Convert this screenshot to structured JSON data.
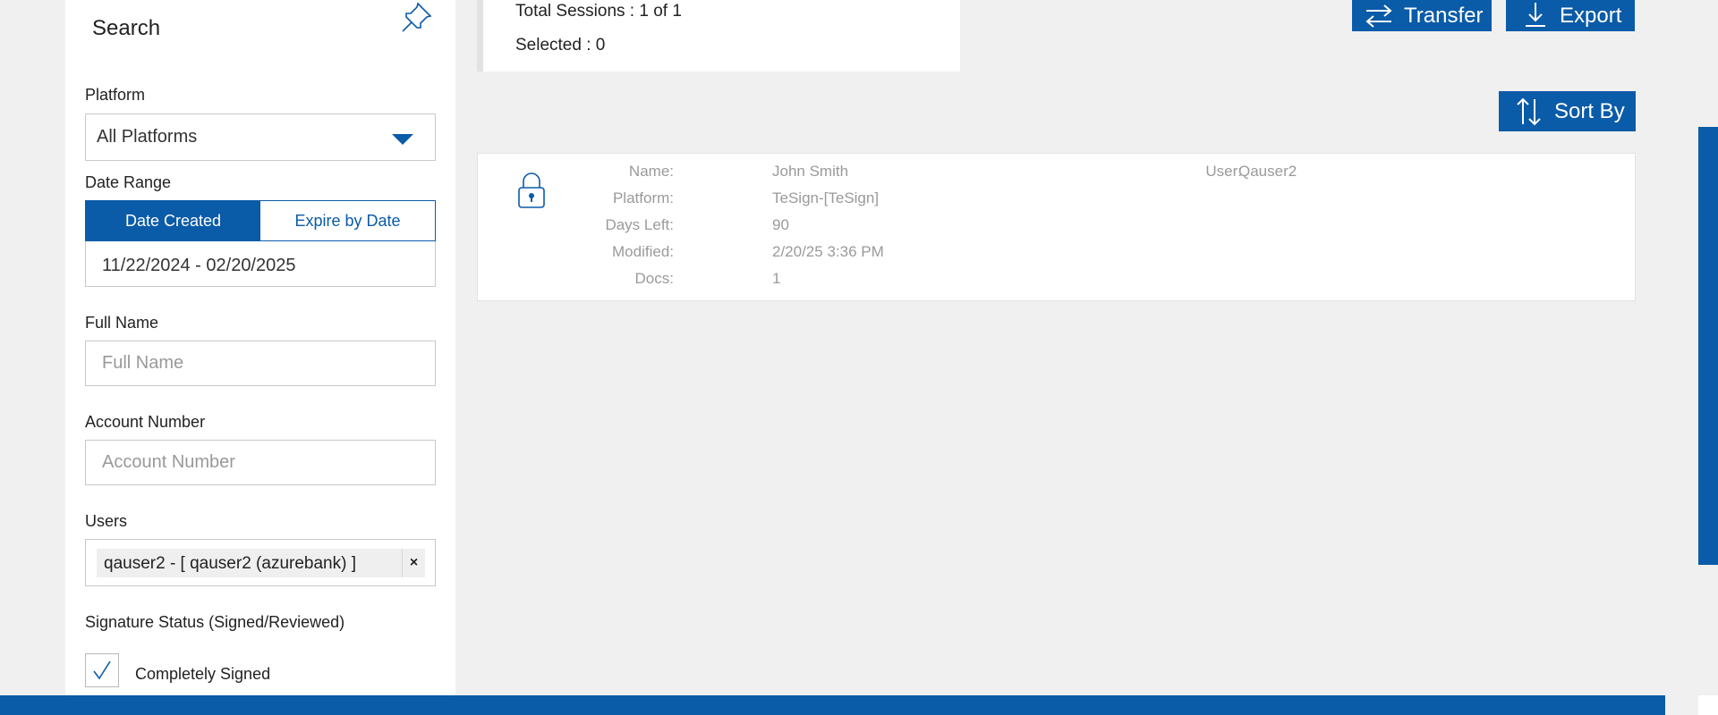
{
  "search_panel": {
    "title": "Search",
    "platform": {
      "label": "Platform",
      "value": "All Platforms"
    },
    "date_range": {
      "label": "Date Range",
      "tabs": [
        "Date Created",
        "Expire by Date"
      ],
      "active_tab": "Date Created",
      "value": "11/22/2024 - 02/20/2025"
    },
    "full_name": {
      "label": "Full Name",
      "placeholder": "Full Name",
      "value": ""
    },
    "account_number": {
      "label": "Account Number",
      "placeholder": "Account Number",
      "value": ""
    },
    "users": {
      "label": "Users",
      "chip": "qauser2 - [ qauser2 (azurebank) ]",
      "remove": "×"
    },
    "signature_status": {
      "label": "Signature Status (Signed/Reviewed)",
      "option": "Completely Signed",
      "checked": true
    }
  },
  "summary": {
    "total_sessions": "Total Sessions : 1 of 1",
    "selected": "Selected : 0"
  },
  "toolbar": {
    "transfer": "Transfer",
    "export": "Export",
    "sort_by": "Sort By"
  },
  "session": {
    "locked": true,
    "fields": [
      {
        "key": "Name:",
        "value": "John Smith"
      },
      {
        "key": "Platform:",
        "value": "TeSign-[TeSign]"
      },
      {
        "key": "Days Left:",
        "value": "90"
      },
      {
        "key": "Modified:",
        "value": "2/20/25 3:36 PM"
      },
      {
        "key": "Docs:",
        "value": "1"
      }
    ],
    "user": {
      "key": "User:",
      "value": "Qauser2"
    }
  },
  "colors": {
    "accent": "#0a5ba8",
    "background": "#f0f0f0"
  },
  "icons": [
    "pin-icon",
    "caret-down-icon",
    "close-icon",
    "checkmark-icon",
    "transfer-icon",
    "export-icon",
    "sort-icon",
    "lock-icon"
  ]
}
